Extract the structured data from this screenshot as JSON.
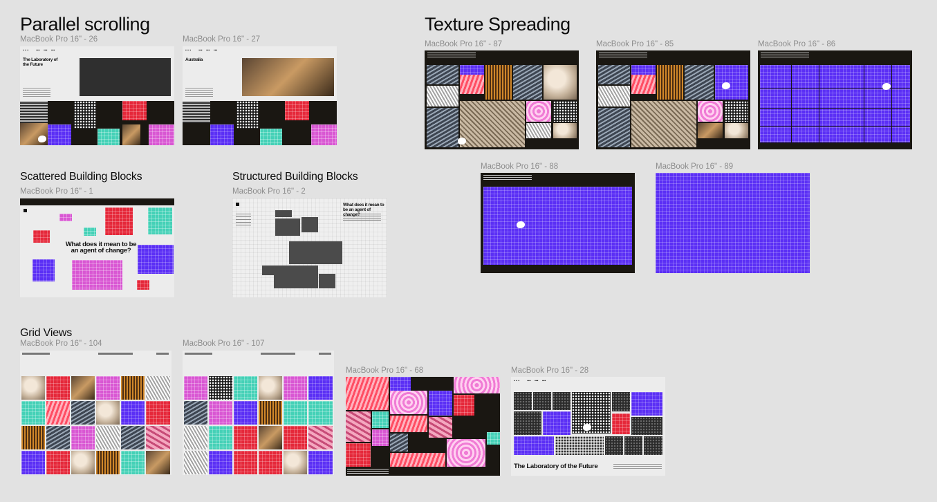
{
  "sections": {
    "parallel": "Parallel scrolling",
    "texture": "Texture Spreading",
    "scattered": "Scattered Building Blocks",
    "structured": "Structured Building Blocks",
    "grid": "Grid Views"
  },
  "frames": {
    "f26": "MacBook Pro 16\" - 26",
    "f27": "MacBook Pro 16\" - 27",
    "f87": "MacBook Pro 16\" - 87",
    "f85": "MacBook Pro 16\" - 85",
    "f86": "MacBook Pro 16\" - 86",
    "f88": "MacBook Pro 16\" - 88",
    "f89": "MacBook Pro 16\" - 89",
    "f1": "MacBook Pro 16\" - 1",
    "f2": "MacBook Pro 16\" - 2",
    "f104": "MacBook Pro 16\" - 104",
    "f107": "MacBook Pro 16\" - 107",
    "f68": "MacBook Pro 16\" - 68",
    "f28": "MacBook Pro 16\" - 28"
  },
  "content": {
    "lab_future_two_line_1": "The Laboratory of",
    "lab_future_two_line_2": "the Future",
    "australia": "Australia",
    "agent_q1": "What does it mean to be",
    "agent_q2": "an agent of change?",
    "agent_q_s1": "What does it mean to",
    "agent_q_s2": "be an agent of change?",
    "lab_future": "The Laboratory of the Future"
  },
  "colors": {
    "background": "#e2e2e2",
    "violet": "#5b2ff5",
    "red": "#e5283a",
    "teal": "#45d1b7",
    "magenta": "#d957d3",
    "dark": "#1a1712"
  }
}
